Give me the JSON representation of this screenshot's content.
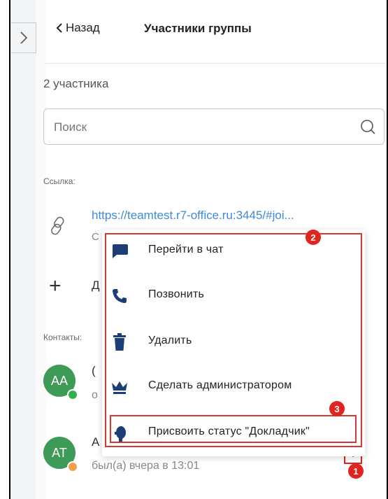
{
  "header": {
    "back_label": "Назад",
    "title": "Участники группы"
  },
  "members_count": "2 участника",
  "search": {
    "placeholder": "Поиск",
    "value": ""
  },
  "link_section": {
    "label": "Ссылка:",
    "url": "https://teamtest.r7-office.ru:3445/#joi...",
    "sub": "С"
  },
  "add_row": {
    "label": "Д"
  },
  "contacts_section": {
    "label": "Контакты:",
    "items": [
      {
        "initials": "AA",
        "name": "(",
        "sub": "о",
        "status_color": "#2fb24c"
      },
      {
        "initials": "AT",
        "name": "А",
        "sub": "был(а) вчера в 13:01",
        "status_color": "#f0a04a"
      }
    ]
  },
  "context_menu": {
    "items": [
      {
        "icon": "chat-bubble-icon",
        "label": "Перейти в чат"
      },
      {
        "icon": "phone-icon",
        "label": "Позвонить"
      },
      {
        "icon": "trash-icon",
        "label": "Удалить"
      },
      {
        "icon": "crown-icon",
        "label": "Сделать администратором"
      },
      {
        "icon": "speaker-icon",
        "label": "Присвоить статус \"Докладчик\""
      }
    ]
  },
  "callouts": [
    "1",
    "2",
    "3"
  ],
  "colors": {
    "accent": "#3d8ad9",
    "avatar": "#3e9a57",
    "highlight": "#e0251e",
    "icon": "#1c3f78"
  }
}
